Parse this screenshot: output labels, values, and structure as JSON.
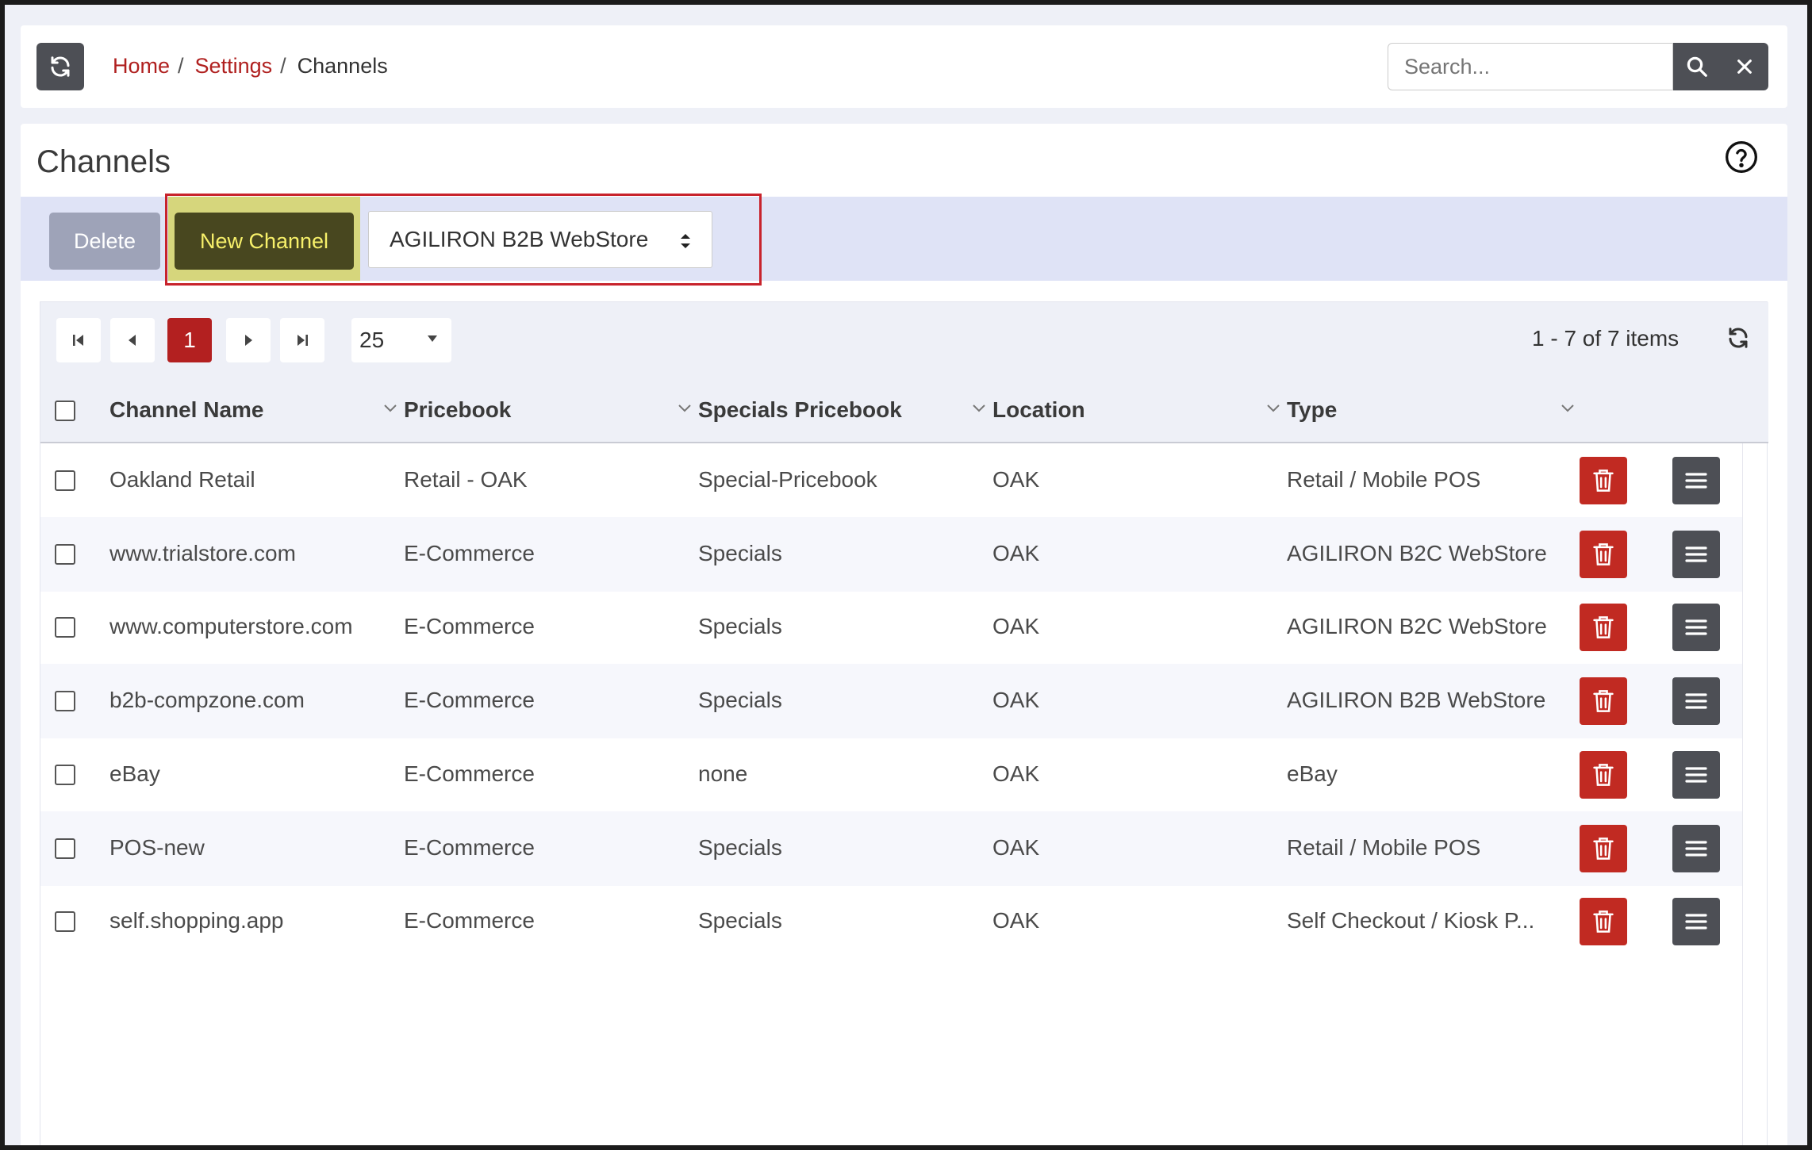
{
  "breadcrumb": {
    "home": "Home",
    "settings": "Settings",
    "current": "Channels"
  },
  "search": {
    "placeholder": "Search..."
  },
  "page": {
    "title": "Channels"
  },
  "toolbar": {
    "delete_label": "Delete",
    "new_label": "New Channel",
    "channel_type_value": "AGILIRON B2B WebStore"
  },
  "pager": {
    "current_page": "1",
    "page_size": "25",
    "info": "1 - 7 of 7 items"
  },
  "columns": {
    "name": "Channel Name",
    "pricebook": "Pricebook",
    "specials": "Specials Pricebook",
    "location": "Location",
    "type": "Type"
  },
  "rows": [
    {
      "name": "Oakland Retail",
      "pricebook": "Retail - OAK",
      "specials": "Special-Pricebook",
      "location": "OAK",
      "type": "Retail / Mobile POS"
    },
    {
      "name": "www.trialstore.com",
      "pricebook": "E-Commerce",
      "specials": "Specials",
      "location": "OAK",
      "type": "AGILIRON B2C WebStore"
    },
    {
      "name": "www.computerstore.com",
      "pricebook": "E-Commerce",
      "specials": "Specials",
      "location": "OAK",
      "type": "AGILIRON B2C WebStore"
    },
    {
      "name": "b2b-compzone.com",
      "pricebook": "E-Commerce",
      "specials": "Specials",
      "location": "OAK",
      "type": "AGILIRON B2B WebStore"
    },
    {
      "name": "eBay",
      "pricebook": "E-Commerce",
      "specials": "none",
      "location": "OAK",
      "type": "eBay"
    },
    {
      "name": "POS-new",
      "pricebook": "E-Commerce",
      "specials": "Specials",
      "location": "OAK",
      "type": "Retail / Mobile POS"
    },
    {
      "name": "self.shopping.app",
      "pricebook": "E-Commerce",
      "specials": "Specials",
      "location": "OAK",
      "type": "Self Checkout / Kiosk P..."
    }
  ],
  "icons": {
    "refresh": "refresh-icon",
    "search": "search-icon",
    "clear": "close-icon",
    "help": "help-circle-icon",
    "trash": "trash-icon",
    "menu": "menu-icon"
  },
  "colors": {
    "brand_red": "#b0201f",
    "dark_button": "#4d4f55",
    "new_button_bg": "#48471f",
    "new_button_text": "#f7f06a",
    "highlight_box": "#c8232c"
  }
}
